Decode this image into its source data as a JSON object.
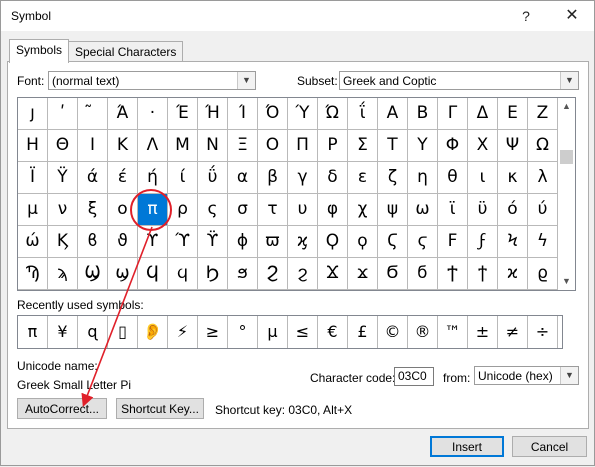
{
  "window": {
    "title": "Symbol",
    "help_glyph": "?",
    "close_glyph": "✕"
  },
  "tabs": [
    {
      "label": "Symbols",
      "active": true
    },
    {
      "label": "Special Characters",
      "active": false
    }
  ],
  "font": {
    "label": "Font:",
    "value": "(normal text)"
  },
  "subset": {
    "label": "Subset:",
    "value": "Greek and Coptic"
  },
  "symbol_grid": {
    "rows": [
      [
        "ȷ",
        "ʹ",
        "͂",
        "Ά",
        "·",
        "Έ",
        "Ή",
        "Ί",
        "Ό",
        "Ύ",
        "Ώ",
        "ΐ",
        "Α",
        "Β",
        "Γ",
        "Δ",
        "Ε",
        "Ζ"
      ],
      [
        "Η",
        "Θ",
        "Ι",
        "Κ",
        "Λ",
        "Μ",
        "Ν",
        "Ξ",
        "Ο",
        "Π",
        "Ρ",
        "Σ",
        "Τ",
        "Υ",
        "Φ",
        "Χ",
        "Ψ",
        "Ω"
      ],
      [
        "Ϊ",
        "Ϋ",
        "ά",
        "έ",
        "ή",
        "ί",
        "ΰ",
        "α",
        "β",
        "γ",
        "δ",
        "ε",
        "ζ",
        "η",
        "θ",
        "ι",
        "κ",
        "λ"
      ],
      [
        "μ",
        "ν",
        "ξ",
        "ο",
        "π",
        "ρ",
        "ς",
        "σ",
        "τ",
        "υ",
        "φ",
        "χ",
        "ψ",
        "ω",
        "ϊ",
        "ϋ",
        "ό",
        "ύ"
      ],
      [
        "ώ",
        "Ϗ",
        "ϐ",
        "ϑ",
        "ϒ",
        "ϓ",
        "ϔ",
        "ϕ",
        "ϖ",
        "ϗ",
        "Ϙ",
        "ϙ",
        "Ϛ",
        "ϛ",
        "Ϝ",
        "ϝ",
        "Ϟ",
        "ϟ"
      ],
      [
        "Ϡ",
        "ϡ",
        "Ϣ",
        "ϣ",
        "Ϥ",
        "ϥ",
        "Ϧ",
        "ϧ",
        "Ϩ",
        "ϩ",
        "Ϫ",
        "ϫ",
        "Ϭ",
        "ϭ",
        "Ϯ",
        "ϯ",
        "ϰ",
        "ϱ"
      ]
    ],
    "selected": {
      "row": 3,
      "col": 4
    }
  },
  "recent": {
    "label": "Recently used symbols:",
    "symbols": [
      "π",
      "¥",
      "ɋ",
      "▯",
      "👂",
      "⚡",
      "≥",
      "°",
      "µ",
      "≤",
      "€",
      "£",
      "©",
      "®",
      "™",
      "±",
      "≠",
      "÷"
    ]
  },
  "unicode": {
    "name_label": "Unicode name:",
    "name_value": "Greek Small Letter Pi"
  },
  "char_code": {
    "label": "Character code:",
    "value": "03C0"
  },
  "from": {
    "label": "from:",
    "value": "Unicode (hex)"
  },
  "buttons": {
    "autocorrect": "AutoCorrect...",
    "shortcut_key": "Shortcut Key...",
    "insert": "Insert",
    "cancel": "Cancel"
  },
  "shortcut_text": "Shortcut key: 03C0, Alt+X",
  "annotation_color": "#e0202a"
}
